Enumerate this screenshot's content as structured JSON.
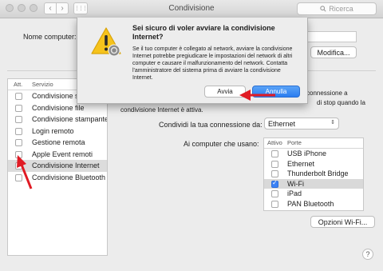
{
  "window": {
    "title": "Condivisione"
  },
  "toolbar": {
    "back_glyph": "‹",
    "forward_glyph": "›",
    "grid_glyph": "⋮⋮⋮",
    "search_placeholder": "Ricerca",
    "search_icon": "magnifier"
  },
  "settings": {
    "computer_name_label": "Nome computer:",
    "edit_button": "Modifica...",
    "service_header_on": "Att.",
    "service_header_name": "Servizio",
    "services": [
      {
        "name": "Condivisione schermo",
        "checked": false,
        "selected": false
      },
      {
        "name": "Condivisione file",
        "checked": false,
        "selected": false
      },
      {
        "name": "Condivisione stampante",
        "checked": false,
        "selected": false
      },
      {
        "name": "Login remoto",
        "checked": false,
        "selected": false
      },
      {
        "name": "Gestione remota",
        "checked": false,
        "selected": false
      },
      {
        "name": "Apple Event remoti",
        "checked": false,
        "selected": false
      },
      {
        "name": "Condivisione Internet",
        "checked": false,
        "selected": true
      },
      {
        "name": "Condivisione Bluetooth",
        "checked": false,
        "selected": false
      }
    ],
    "desc_line1": "connessione a",
    "desc_line2": "di stop quando la",
    "desc_line3": "condivisione Internet è attiva.",
    "share_from_label": "Condividi la tua connessione da:",
    "share_from_value": "Ethernet",
    "to_computers_label": "Ai computer che usano:",
    "ports_header_on": "Attivo",
    "ports_header_name": "Porte",
    "ports": [
      {
        "name": "USB iPhone",
        "checked": false,
        "selected": false
      },
      {
        "name": "Ethernet",
        "checked": false,
        "selected": false
      },
      {
        "name": "Thunderbolt Bridge",
        "checked": false,
        "selected": false
      },
      {
        "name": "Wi-Fi",
        "checked": true,
        "selected": true
      },
      {
        "name": "iPad",
        "checked": false,
        "selected": false
      },
      {
        "name": "PAN Bluetooth",
        "checked": false,
        "selected": false
      }
    ],
    "wifi_options_button": "Opzioni Wi-Fi...",
    "help_button": "?"
  },
  "dialog": {
    "title": "Sei sicuro di voler avviare la condivisione Internet?",
    "message": "Se il tuo computer è collegato al network, avviare la condivisione Internet potrebbe pregiudicare le impostazioni del network di altri computer e causare il malfunzionamento del network. Contatta l'amministratore del sistema prima di avviare la condivisione Internet.",
    "start_button": "Avvia",
    "cancel_button": "Annulla",
    "icon": "warning-triangle"
  },
  "colors": {
    "annotation_arrow": "#e01b24",
    "accent_blue": "#2b7cf0"
  }
}
